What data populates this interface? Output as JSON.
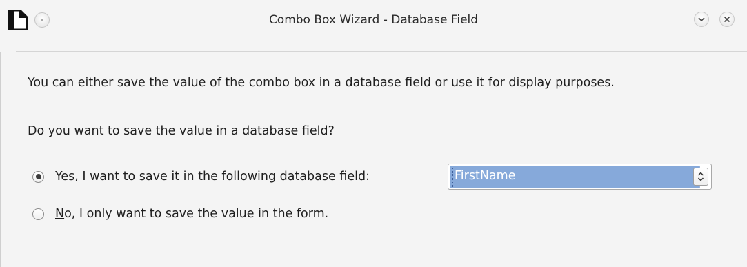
{
  "window": {
    "title": "Combo Box Wizard - Database Field"
  },
  "icons": {
    "app": "libreoffice-document-icon",
    "menu": "window-menu-icon",
    "minimize": "chevron-down-icon",
    "close": "close-icon",
    "combo_arrow": "up-down-chevron-icon"
  },
  "content": {
    "description": "You can either save the value of the combo box in a database field or use it for display purposes.",
    "question": "Do you want to save the value in a database field?",
    "options": [
      {
        "mnemonic": "Y",
        "label_rest": "es, I want to save it in the following database field:",
        "checked": true
      },
      {
        "mnemonic": "N",
        "label_rest": "o, I only want to save the value in the form.",
        "checked": false
      }
    ],
    "database_field": {
      "value": "FirstName"
    }
  },
  "colors": {
    "selection": "#86a9da",
    "background": "#f4f4f4",
    "text": "#1f1f1f"
  }
}
